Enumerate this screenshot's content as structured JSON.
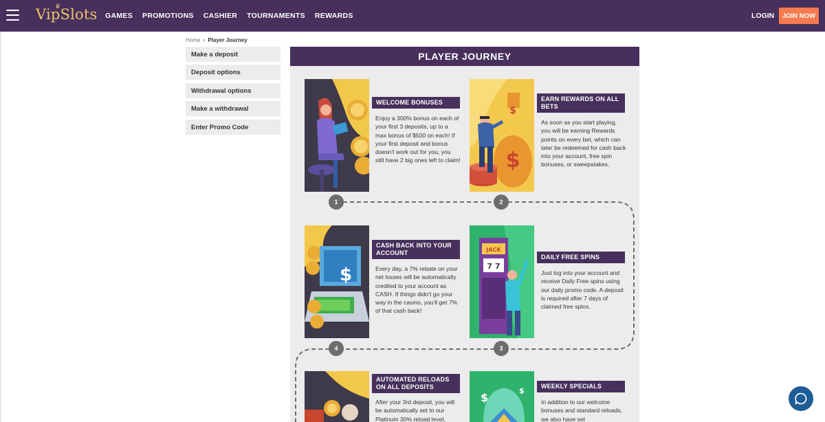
{
  "header": {
    "logo": "VipSlots",
    "nav": [
      "GAMES",
      "PROMOTIONS",
      "CASHIER",
      "TOURNAMENTS",
      "REWARDS"
    ],
    "login": "LOGIN",
    "join": "JOIN NOW"
  },
  "breadcrumb": {
    "home": "Home",
    "current": "Player Journey"
  },
  "sidebar": {
    "items": [
      {
        "label": "Make a deposit"
      },
      {
        "label": "Deposit options"
      },
      {
        "label": "Withdrawal options"
      },
      {
        "label": "Make a withdrawal"
      },
      {
        "label": "Enter Promo Code"
      }
    ]
  },
  "panel": {
    "title": "PLAYER JOURNEY",
    "cards": [
      {
        "title": "WELCOME BONUSES",
        "text": "Enjoy a 300% bonus on each of your first 3 deposits, up to a max bonus of $500 on each! If your first deposit and bonus doesn't work out for you, you still have 2 big ones left to claim!"
      },
      {
        "title": "EARN REWARDS ON ALL BETS",
        "text": "As soon as you start playing, you will be earning Rewards points on every bet, which can later be redeemed for cash back into your account, free spin bonuses, or sweepstakes."
      },
      {
        "title": "CASH BACK INTO YOUR ACCOUNT",
        "text": "Every day, a 7% rebate on your net losses will be automatically credited to your account as CASH. If things didn't go your way in the casino, you'll get 7% of that cash back!"
      },
      {
        "title": "DAILY FREE SPINS",
        "text": "Just log into your account and receive Daily Free spins using our daily promo code. A deposit is required after 7 days of claimed free spins."
      },
      {
        "title": "AUTOMATED RELOADS ON ALL DEPOSITS",
        "text": "After your 3rd deposit, you will be automatically set to our Platinum 30% reload level,"
      },
      {
        "title": "WEEKLY SPECIALS",
        "text": "In addition to our welcome bonuses and standard reloads, we also have set"
      }
    ],
    "steps": [
      "1",
      "2",
      "3",
      "4"
    ]
  }
}
